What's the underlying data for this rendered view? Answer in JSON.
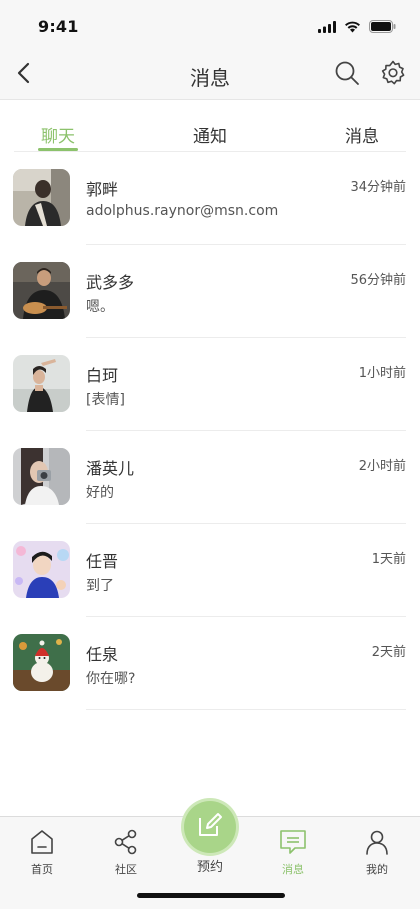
{
  "status_bar": {
    "time": "9:41",
    "icons": [
      "signal-icon",
      "wifi-icon",
      "battery-icon"
    ]
  },
  "nav": {
    "title": "消息",
    "back_icon": "chevron-left-icon",
    "search_icon": "search-icon",
    "settings_icon": "gear-icon"
  },
  "tabs": [
    {
      "label": "聊天",
      "active": true
    },
    {
      "label": "通知",
      "active": false
    },
    {
      "label": "消息",
      "active": false
    }
  ],
  "conversations": [
    {
      "name": "郭畔",
      "time": "34分钟前",
      "preview": "adolphus.raynor@msn.com"
    },
    {
      "name": "武多多",
      "time": "56分钟前",
      "preview": "嗯。"
    },
    {
      "name": "白珂",
      "time": "1小时前",
      "preview": "[表情]"
    },
    {
      "name": "潘英儿",
      "time": "2小时前",
      "preview": "好的"
    },
    {
      "name": "任晋",
      "time": "1天前",
      "preview": "到了"
    },
    {
      "name": "任泉",
      "time": "2天前",
      "preview": "你在哪?"
    }
  ],
  "tab_bar": {
    "items": [
      {
        "label": "首页",
        "icon": "home-icon",
        "active": false
      },
      {
        "label": "社区",
        "icon": "share-icon",
        "active": false
      },
      {
        "label": "预约",
        "icon": "edit-icon",
        "active": false
      },
      {
        "label": "消息",
        "icon": "message-icon",
        "active": true
      },
      {
        "label": "我的",
        "icon": "user-icon",
        "active": false
      }
    ]
  },
  "colors": {
    "accent": "#8cc26c",
    "fab": "#a9d589",
    "text": "#333333",
    "bar_bg": "#f7f7f7"
  }
}
